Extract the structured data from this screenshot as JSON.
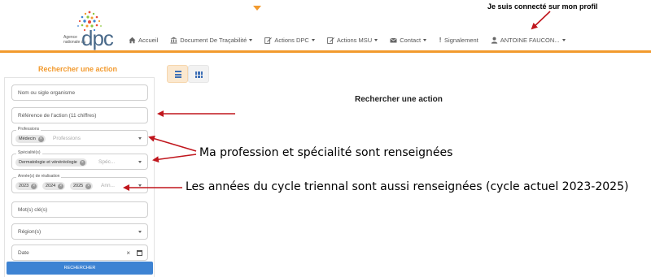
{
  "header": {
    "logo_line1": "Agence",
    "logo_line2": "nationale du",
    "logo_mark": "dpc",
    "nav": [
      {
        "icon": "home-icon",
        "label": "Accueil",
        "caret": false
      },
      {
        "icon": "bank-icon",
        "label": "Document De Traçabilité",
        "caret": true
      },
      {
        "icon": "edit-icon",
        "label": "Actions DPC",
        "caret": true
      },
      {
        "icon": "edit-icon",
        "label": "Actions MSU",
        "caret": true
      },
      {
        "icon": "envelope-icon",
        "label": "Contact",
        "caret": true
      },
      {
        "icon": "exclamation-icon",
        "label": "Signalement",
        "caret": false
      },
      {
        "icon": "user-icon",
        "label": "ANTOINE FAUCON...",
        "caret": true
      }
    ]
  },
  "search_panel": {
    "title": "Rechercher une action",
    "organisme_placeholder": "Nom ou sigle organisme",
    "reference_placeholder": "Référence de l'action (11 chiffres)",
    "professions": {
      "label": "Professions",
      "chips": [
        "Médecin"
      ],
      "placeholder": "Professions"
    },
    "specialites": {
      "label": "Spécialité(s)",
      "chips": [
        "Dermatologie et vénéréologie"
      ],
      "placeholder": "Spéc..."
    },
    "annees": {
      "label": "Année(s) de réalisation",
      "chips": [
        "2023",
        "2024",
        "2025"
      ],
      "placeholder": "Ann..."
    },
    "keywords_placeholder": "Mot(s) clé(s)",
    "region_placeholder": "Région(s)",
    "date_placeholder": "Date",
    "submit_label": "RECHERCHER"
  },
  "main": {
    "title": "Rechercher une action"
  },
  "annotations": {
    "profile": "Je suis connecté sur mon profil",
    "profession": "Ma profession et spécialité sont renseignées",
    "years": "Les années du cycle triennal sont aussi renseignées (cycle actuel 2023-2025)"
  },
  "colors": {
    "accent": "#f29a2e",
    "button": "#3d83d3",
    "arrow": "#c0161d"
  }
}
